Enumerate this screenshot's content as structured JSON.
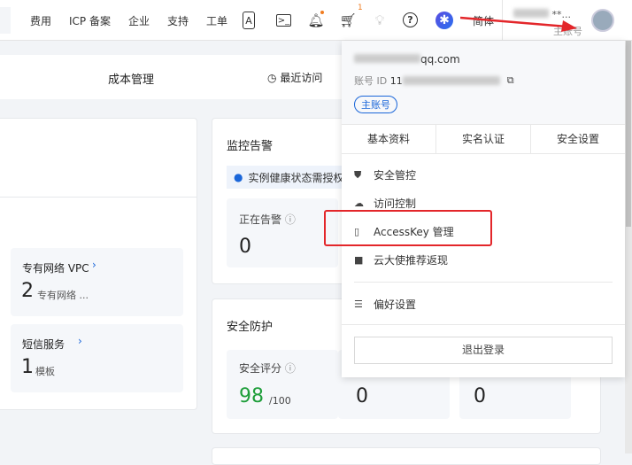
{
  "topbar": {
    "nav": [
      "费用",
      "ICP 备案",
      "企业",
      "支持",
      "工单"
    ],
    "icons": [
      "api-icon",
      "terminal-icon",
      "bell-icon",
      "cart-icon",
      "lightbulb-icon",
      "help-icon",
      "app-logo-icon"
    ],
    "cart_count": "1",
    "language": "简体",
    "username": "**...",
    "account_type": "主账号"
  },
  "subbar": {
    "cost": "成本管理",
    "recent": "最近访问"
  },
  "tiles": [
    {
      "title": "专有网络 VPC",
      "count": "2",
      "unit": "专有网络 ..."
    },
    {
      "title": "短信服务",
      "count": "1",
      "unit": "模板"
    }
  ],
  "monitor": {
    "title": "监控告警",
    "notice": "实例健康状态需授权",
    "alarm_label": "正在告警",
    "alarm_value": "0"
  },
  "security": {
    "title": "安全防护",
    "score_label": "安全评分",
    "score": "98",
    "score_max": "/100",
    "v2": "0",
    "v3": "0"
  },
  "panel": {
    "account_id_label": "账号 ID",
    "id_prefix": "11",
    "email_suffix": "qq.com",
    "badge": "主账号",
    "tabs": [
      "基本资料",
      "实名认证",
      "安全设置"
    ],
    "items": [
      {
        "icon": "shield-icon",
        "label": "安全管控"
      },
      {
        "icon": "cloud-icon",
        "label": "访问控制"
      },
      {
        "icon": "key-icon",
        "label": "AccessKey 管理"
      },
      {
        "icon": "book-icon",
        "label": "云大使推荐返现"
      }
    ],
    "prefs": "偏好设置",
    "logout": "退出登录"
  },
  "colors": {
    "accent": "#1a66d9",
    "highlight": "#e3262a",
    "score": "#1e9e3a",
    "dot": "#f07c21"
  }
}
